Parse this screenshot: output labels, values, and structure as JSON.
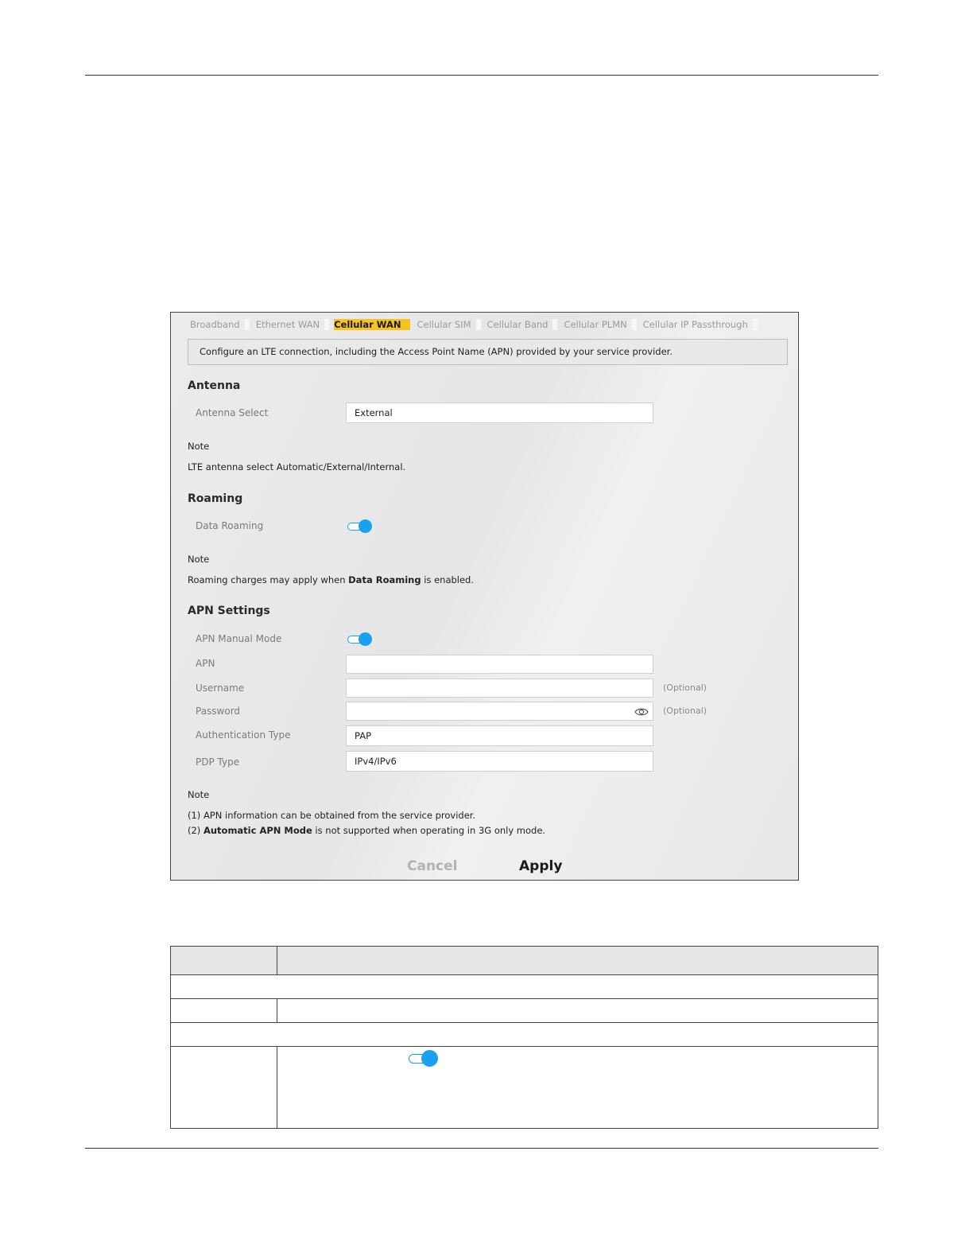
{
  "tabs": [
    "Broadband",
    "Ethernet WAN",
    "Cellular WAN",
    "Cellular SIM",
    "Cellular Band",
    "Cellular PLMN",
    "Cellular IP Passthrough"
  ],
  "active_tab": "Cellular WAN",
  "description": "Configure an LTE connection, including the Access Point Name (APN) provided by your service provider.",
  "antenna": {
    "heading": "Antenna",
    "select_label": "Antenna Select",
    "select_value": "External",
    "note_heading": "Note",
    "note_text": "LTE antenna select Automatic/External/Internal."
  },
  "roaming": {
    "heading": "Roaming",
    "data_roaming_label": "Data Roaming",
    "data_roaming_on": true,
    "note_heading": "Note",
    "note_prefix": "Roaming charges may apply when ",
    "note_bold": "Data Roaming",
    "note_suffix": " is enabled."
  },
  "apn": {
    "heading": "APN Settings",
    "manual_mode_label": "APN Manual Mode",
    "manual_mode_on": true,
    "apn_label": "APN",
    "apn_value": "",
    "username_label": "Username",
    "username_value": "",
    "username_hint": "(Optional)",
    "password_label": "Password",
    "password_value": "",
    "password_hint": "(Optional)",
    "auth_label": "Authentication Type",
    "auth_value": "PAP",
    "pdp_label": "PDP Type",
    "pdp_value": "IPv4/IPv6",
    "note_heading": "Note",
    "note1": "(1) APN information can be obtained from the service provider.",
    "note2_prefix": "(2) ",
    "note2_bold": "Automatic APN Mode",
    "note2_suffix": " is not supported when operating in 3G only mode."
  },
  "buttons": {
    "cancel": "Cancel",
    "apply": "Apply"
  },
  "colors": {
    "accent_yellow": "#f7c31c",
    "toggle_blue": "#1aa0f0"
  }
}
